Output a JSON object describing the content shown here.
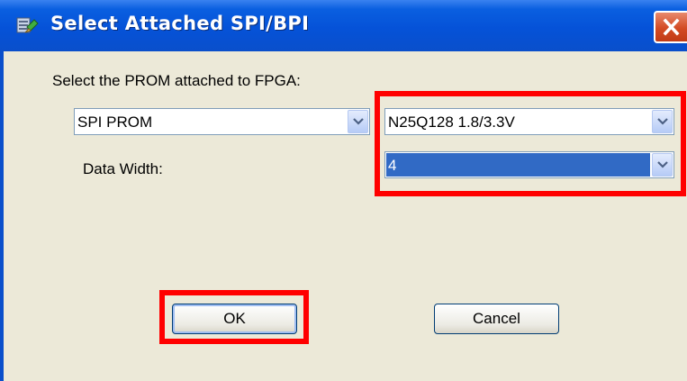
{
  "window": {
    "title": "Select Attached SPI/BPI",
    "title_icon": "prom-device-icon",
    "close_icon": "close-icon"
  },
  "form": {
    "prompt_label": "Select the PROM attached to FPGA:",
    "prom_type": {
      "value": "SPI PROM"
    },
    "prom_part": {
      "value": "N25Q128 1.8/3.3V"
    },
    "data_width": {
      "label": "Data Width:",
      "value": "4"
    }
  },
  "buttons": {
    "ok": "OK",
    "cancel": "Cancel"
  },
  "colors": {
    "titlebar": "#0552d8",
    "dialog_bg": "#ece9d8",
    "selection": "#316ac5",
    "highlight": "#ff0000",
    "close_button": "#d34a23"
  }
}
